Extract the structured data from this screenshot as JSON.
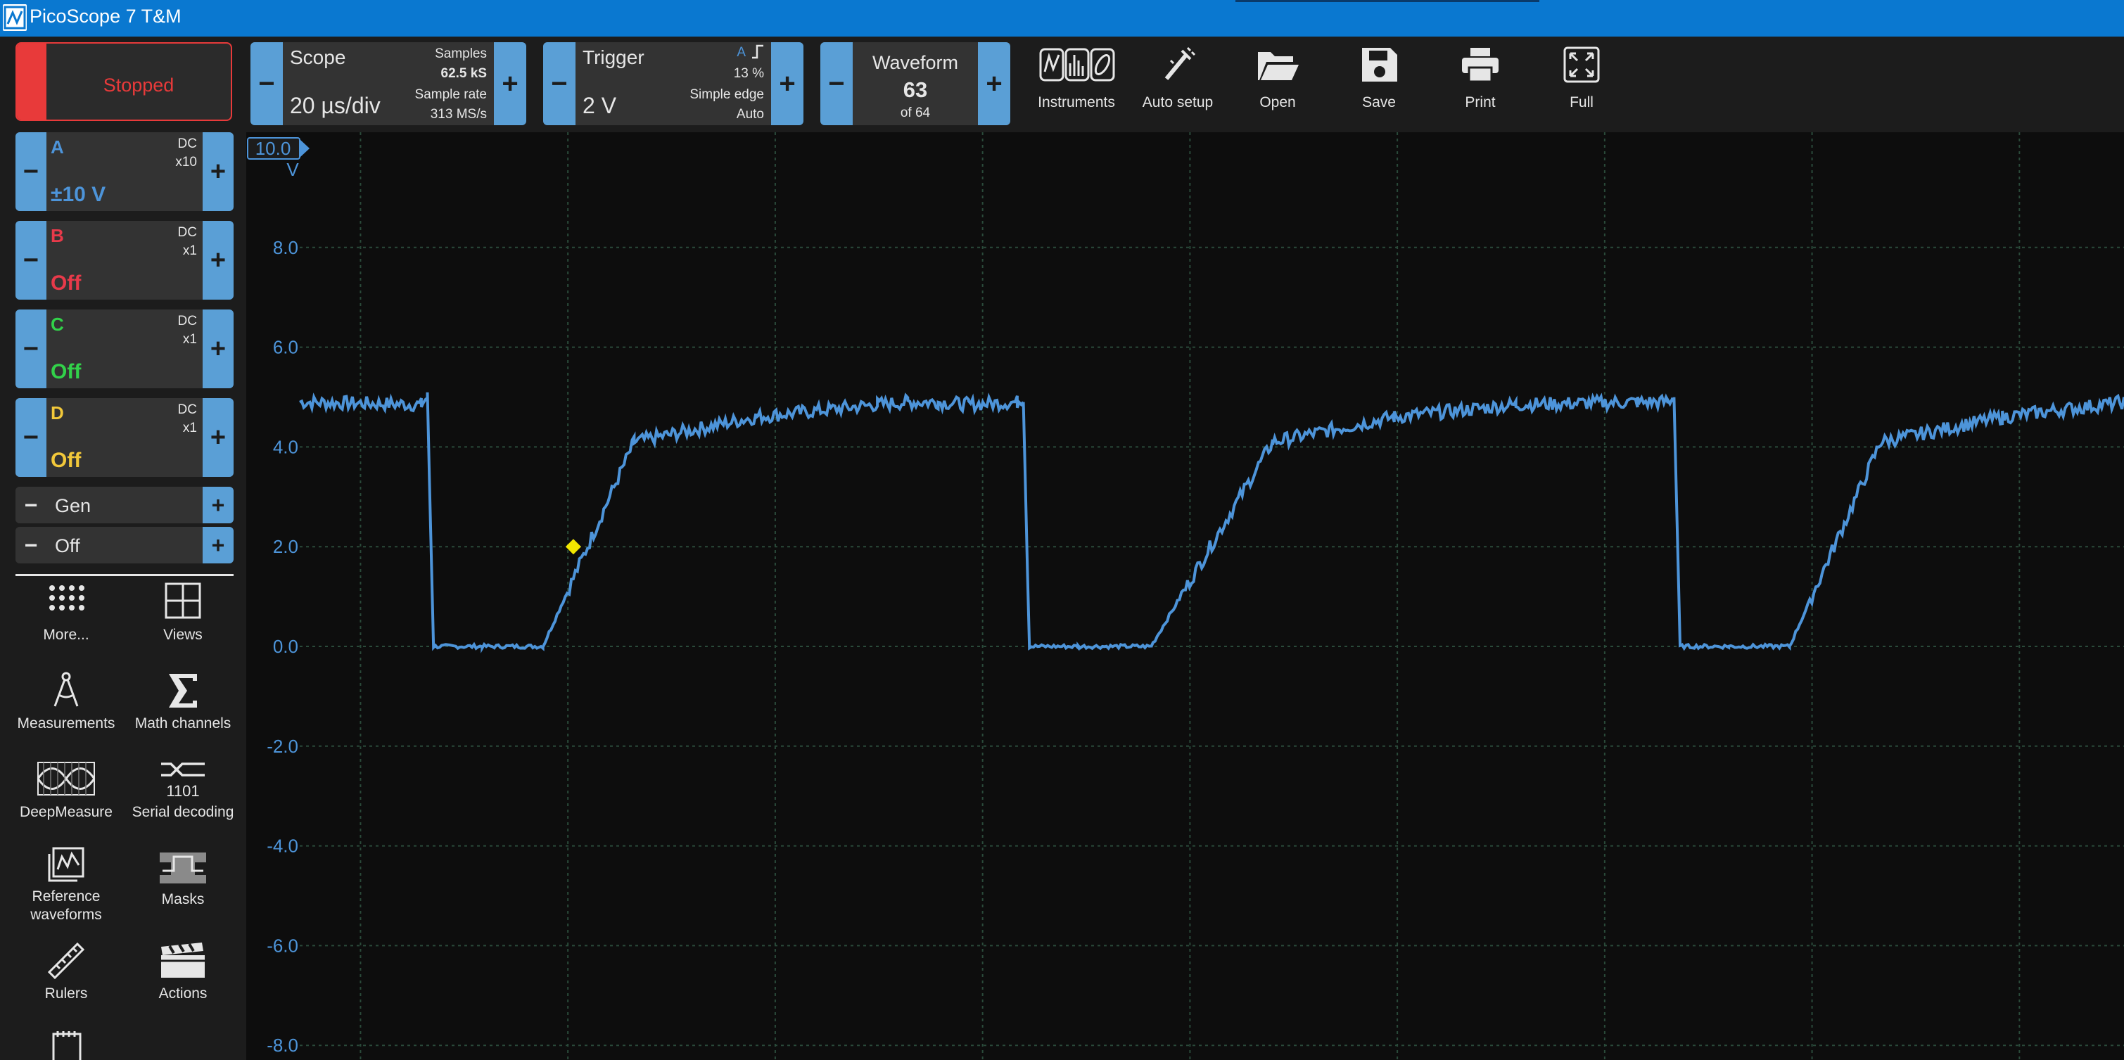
{
  "window": {
    "title": "PicoScope 7 T&M"
  },
  "run_button": {
    "label": "Stopped"
  },
  "scope": {
    "label": "Scope",
    "timebase": "20 µs/div",
    "samples_label": "Samples",
    "samples_value": "62.5 kS",
    "sample_rate_label": "Sample rate",
    "sample_rate_value": "313 MS/s"
  },
  "trigger": {
    "label": "Trigger",
    "level": "2 V",
    "channel": "A",
    "percent": "13 %",
    "type": "Simple edge",
    "mode": "Auto"
  },
  "waveform": {
    "label": "Waveform",
    "current": "63",
    "total": "of 64"
  },
  "tools": [
    {
      "label": "Instruments",
      "icon": "instruments-icon"
    },
    {
      "label": "Auto setup",
      "icon": "auto-setup-icon"
    },
    {
      "label": "Open",
      "icon": "folder-open-icon"
    },
    {
      "label": "Save",
      "icon": "save-icon"
    },
    {
      "label": "Print",
      "icon": "print-icon"
    },
    {
      "label": "Full",
      "icon": "fullscreen-icon"
    }
  ],
  "channels": [
    {
      "name": "A",
      "coupling": "DC",
      "probe": "x10",
      "range": "±10 V",
      "color": "#4d94d9"
    },
    {
      "name": "B",
      "coupling": "DC",
      "probe": "x1",
      "range": "Off",
      "color": "#e83a4a"
    },
    {
      "name": "C",
      "coupling": "DC",
      "probe": "x1",
      "range": "Off",
      "color": "#32d24a"
    },
    {
      "name": "D",
      "coupling": "DC",
      "probe": "x1",
      "range": "Off",
      "color": "#f2c83a"
    }
  ],
  "generator": {
    "label": "Gen",
    "state": "Off"
  },
  "panel_tiles": [
    {
      "label": "More...",
      "icon": "more-icon"
    },
    {
      "label": "Views",
      "icon": "views-icon"
    },
    {
      "label": "Measurements",
      "icon": "measurements-icon"
    },
    {
      "label": "Math channels",
      "icon": "sigma-icon"
    },
    {
      "label": "DeepMeasure",
      "icon": "deepmeasure-icon"
    },
    {
      "label": "Serial decoding",
      "icon": "serial-decoding-icon"
    },
    {
      "label": "Reference waveforms",
      "icon": "reference-waveforms-icon"
    },
    {
      "label": "Masks",
      "icon": "masks-icon"
    },
    {
      "label": "Rulers",
      "icon": "ruler-icon"
    },
    {
      "label": "Actions",
      "icon": "clapperboard-icon"
    }
  ],
  "colors": {
    "accent": "#5a9fd6",
    "trace": "#4d94d9",
    "stopped": "#e83a3a",
    "trigger_marker": "#f2e600"
  },
  "chart_data": {
    "type": "line",
    "title": "",
    "xlabel": "",
    "ylabel": "",
    "ylim": [
      -8.0,
      10.0
    ],
    "y_ticks": [
      "8.0",
      "6.0",
      "4.0",
      "2.0",
      "0.0",
      "-2.0",
      "-4.0",
      "-6.0",
      "-8.0"
    ],
    "top_scale": {
      "value": "10.0",
      "unit": "V"
    },
    "grid": true,
    "series": [
      {
        "name": "A",
        "x": [
          0,
          20,
          21,
          22,
          30,
          40,
          55,
          75,
          95,
          100,
          105,
          110,
          118,
          119,
          120,
          128,
          140,
          160,
          180,
          200,
          220,
          225,
          226,
          227,
          235,
          245,
          260,
          280,
          300
        ],
        "y": [
          4.9,
          4.85,
          5.0,
          0.0,
          0.0,
          0.0,
          4.1,
          4.6,
          4.85,
          4.9,
          4.9,
          4.85,
          4.9,
          5.0,
          0.0,
          0.0,
          0.0,
          4.1,
          4.6,
          4.85,
          4.9,
          4.9,
          5.0,
          0.0,
          0.0,
          0.0,
          4.1,
          4.6,
          4.9
        ]
      }
    ],
    "trigger_point": {
      "x": 45,
      "y": 2.0
    }
  }
}
